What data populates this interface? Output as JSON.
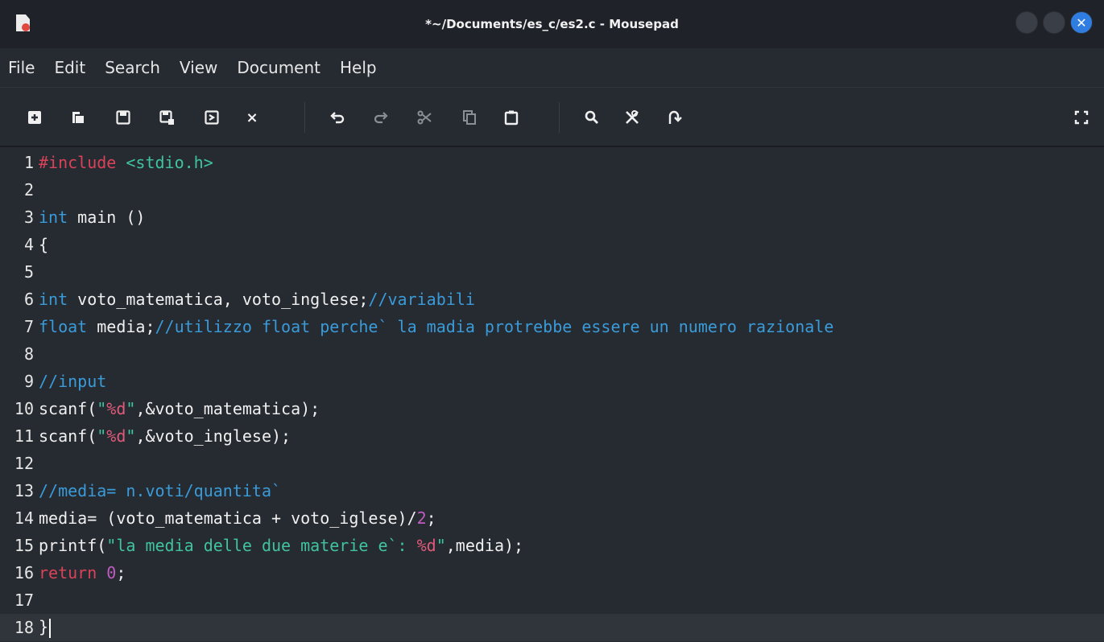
{
  "window": {
    "title": "*~/Documents/es_c/es2.c - Mousepad",
    "close_glyph": "✕"
  },
  "menu": [
    "File",
    "Edit",
    "Search",
    "View",
    "Document",
    "Help"
  ],
  "toolbar": {
    "icons": [
      "new-file-icon",
      "open-file-icon",
      "save-icon",
      "save-as-icon",
      "reload-icon",
      "close-tab-icon",
      "undo-icon",
      "redo-icon",
      "cut-icon",
      "copy-icon",
      "paste-icon",
      "find-icon",
      "find-replace-icon",
      "go-to-line-icon",
      "fullscreen-icon"
    ],
    "close_glyph": "×"
  },
  "editor": {
    "current_line": 18,
    "lines": [
      {
        "n": "1",
        "parts": [
          {
            "t": "#include ",
            "c": "kw-pre"
          },
          {
            "t": "<stdio.h>",
            "c": "str2"
          }
        ]
      },
      {
        "n": "2",
        "parts": []
      },
      {
        "n": "3",
        "parts": [
          {
            "t": "int",
            "c": "kw"
          },
          {
            "t": " main ()",
            "c": "code"
          }
        ]
      },
      {
        "n": "4",
        "parts": [
          {
            "t": "{",
            "c": "code"
          }
        ]
      },
      {
        "n": "5",
        "parts": []
      },
      {
        "n": "6",
        "parts": [
          {
            "t": "int",
            "c": "kw"
          },
          {
            "t": " voto_matematica, voto_inglese;",
            "c": "code"
          },
          {
            "t": "//variabili",
            "c": "cm"
          }
        ]
      },
      {
        "n": "7",
        "parts": [
          {
            "t": "float",
            "c": "kw"
          },
          {
            "t": " media;",
            "c": "code"
          },
          {
            "t": "//utilizzo float perche` la madia protrebbe essere un numero razionale",
            "c": "cm"
          }
        ]
      },
      {
        "n": "8",
        "parts": []
      },
      {
        "n": "9",
        "parts": [
          {
            "t": "//input",
            "c": "cm"
          }
        ]
      },
      {
        "n": "10",
        "parts": [
          {
            "t": "scanf(",
            "c": "code"
          },
          {
            "t": "\"",
            "c": "str2"
          },
          {
            "t": "%d",
            "c": "str"
          },
          {
            "t": "\"",
            "c": "str2"
          },
          {
            "t": ",&voto_matematica);",
            "c": "code"
          }
        ]
      },
      {
        "n": "11",
        "parts": [
          {
            "t": "scanf(",
            "c": "code"
          },
          {
            "t": "\"",
            "c": "str2"
          },
          {
            "t": "%d",
            "c": "str"
          },
          {
            "t": "\"",
            "c": "str2"
          },
          {
            "t": ",&voto_inglese);",
            "c": "code"
          }
        ]
      },
      {
        "n": "12",
        "parts": []
      },
      {
        "n": "13",
        "parts": [
          {
            "t": "//media= n.voti/quantita`",
            "c": "cm"
          }
        ]
      },
      {
        "n": "14",
        "parts": [
          {
            "t": "media= (voto_matematica + voto_iglese)/",
            "c": "code"
          },
          {
            "t": "2",
            "c": "num"
          },
          {
            "t": ";",
            "c": "code"
          }
        ]
      },
      {
        "n": "15",
        "parts": [
          {
            "t": "printf(",
            "c": "code"
          },
          {
            "t": "\"la media delle due materie e`: ",
            "c": "str2"
          },
          {
            "t": "%d",
            "c": "str"
          },
          {
            "t": "\"",
            "c": "str2"
          },
          {
            "t": ",media);",
            "c": "code"
          }
        ]
      },
      {
        "n": "16",
        "parts": [
          {
            "t": "return",
            "c": "ret"
          },
          {
            "t": " ",
            "c": "code"
          },
          {
            "t": "0",
            "c": "num"
          },
          {
            "t": ";",
            "c": "code"
          }
        ]
      },
      {
        "n": "17",
        "parts": []
      },
      {
        "n": "18",
        "parts": [
          {
            "t": "}",
            "c": "code"
          }
        ]
      }
    ]
  }
}
